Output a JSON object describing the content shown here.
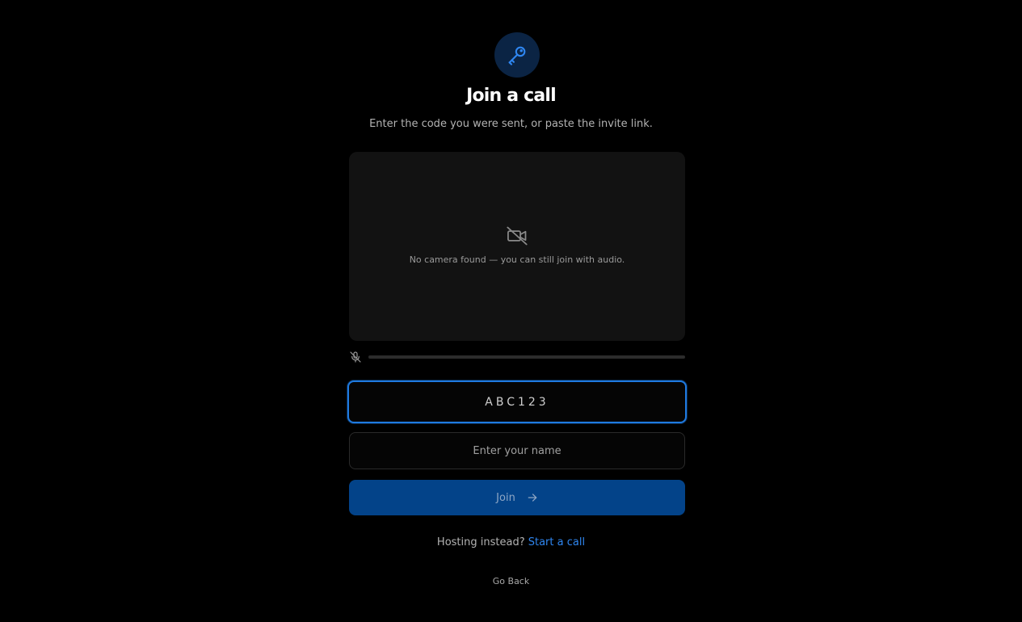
{
  "header": {
    "icon": "key-icon",
    "title": "Join a call",
    "subtitle": "Enter the code you were sent, or paste the invite link."
  },
  "preview": {
    "icon": "camera-off-icon",
    "message": "No camera found — you can still join with audio."
  },
  "mic": {
    "icon": "mic-off-icon",
    "level": 0
  },
  "form": {
    "code_value": "ABC123",
    "name_placeholder": "Enter your name",
    "join_label": "Join",
    "join_icon": "arrow-right-icon"
  },
  "footer": {
    "hosting_question": "Hosting instead?",
    "start_link": "Start a call",
    "go_back": "Go Back"
  },
  "colors": {
    "accent": "#1f7ae0",
    "link": "#2f86f0",
    "button_bg": "#034389",
    "icon_circle": "#0b2444"
  }
}
